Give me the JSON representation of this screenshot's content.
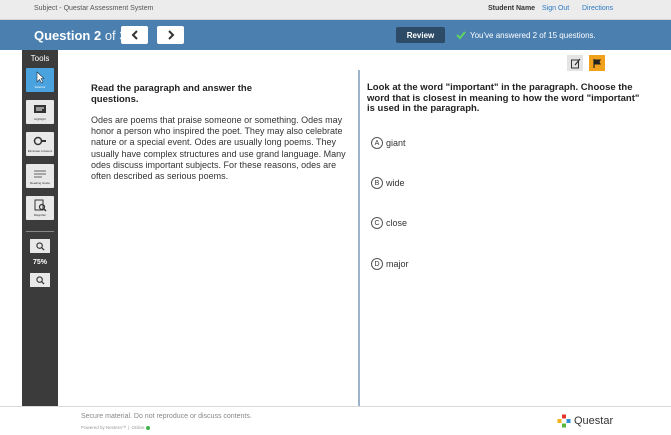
{
  "topbar": {
    "subject": "Subject - Questar Assessment System",
    "student_name_label": "Student Name",
    "sign_out": "Sign Out",
    "directions": "Directions"
  },
  "question_bar": {
    "question_label": "Question 2",
    "of_total": "of 30",
    "review_label": "Review",
    "answered_text": "You've answered 2 of 15 questions."
  },
  "tools": {
    "label": "Tools",
    "items": [
      {
        "name": "Selector",
        "icon": "cursor-icon",
        "active": true
      },
      {
        "name": "Highlight",
        "icon": "highlighter-icon",
        "active": false
      },
      {
        "name": "Eliminate Answers",
        "icon": "eliminate-icon",
        "active": false
      },
      {
        "name": "Reading Guide",
        "icon": "reading-guide-icon",
        "active": false
      },
      {
        "name": "Magnifier",
        "icon": "magnifier-icon",
        "active": false
      }
    ],
    "zoom_level": "75%"
  },
  "passage": {
    "instruction": "Read the paragraph and answer the questions.",
    "text": "Odes are poems that praise someone or something. Odes may honor a person who inspired the poet. They may also celebrate nature or a special event. Odes are usually long poems. They usually have complex structures and use grand language. Many odes discuss important subjects. For these reasons, odes are often described as serious poems."
  },
  "question": {
    "prompt": "Look at the word \"important\" in the paragraph. Choose the word that is closest in meaning to how the word \"important\" is used in the paragraph.",
    "options": [
      {
        "letter": "A",
        "text": "giant"
      },
      {
        "letter": "B",
        "text": "wide"
      },
      {
        "letter": "C",
        "text": "close"
      },
      {
        "letter": "D",
        "text": "major"
      }
    ]
  },
  "footer": {
    "secure": "Secure material. Do not reproduce or discuss contents.",
    "powered": "Powered by Nextera™",
    "online": "Online",
    "logo_text": "Questar"
  },
  "colors": {
    "question_bar": "#4a7fb0",
    "tools_bar": "#3b3b3b",
    "active_tool": "#4aa3de",
    "flag": "#f0a21c",
    "check": "#5fd35f"
  }
}
